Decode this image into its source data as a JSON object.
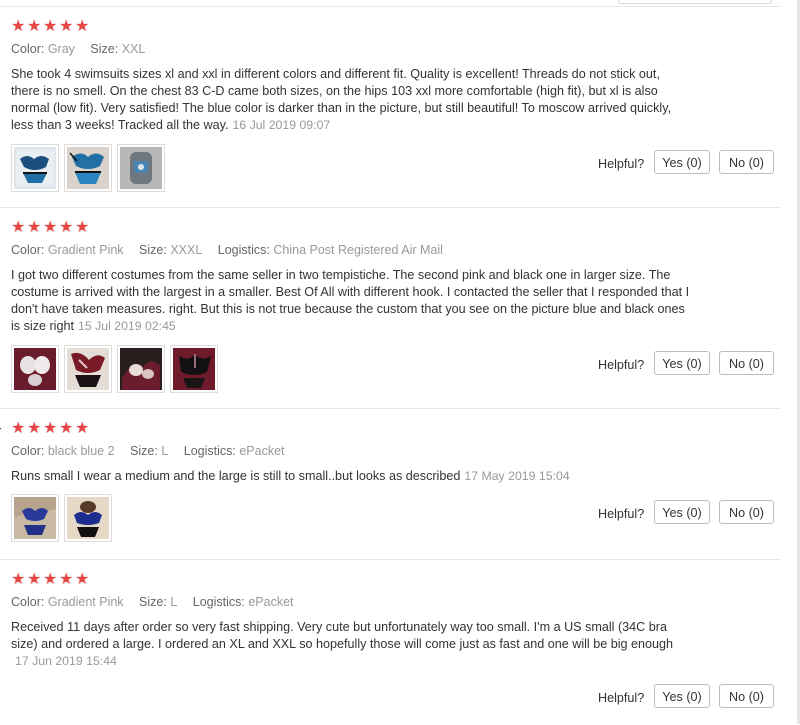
{
  "labels": {
    "color": "Color:",
    "size": "Size:",
    "logistics": "Logistics:",
    "helpful": "Helpful?",
    "star_glyph": "★"
  },
  "icons": {
    "star": "star-icon"
  },
  "colors": {
    "star": "#e64545",
    "meta": "#999999",
    "text": "#333333",
    "border": "#bdbdbd"
  },
  "reviews": [
    {
      "rating": 5,
      "color": "Gray",
      "size": "XXL",
      "logistics": "",
      "text": "She took 4 swimsuits sizes xl and xxl in different colors and different fit. Quality is excellent! Threads do not stick out, there is no smell. On the chest 83 C-D came both sizes, on the hips 103 xxl more comfortable (high fit), but xl is also normal (low fit). Very satisfied! The blue color is darker than in the picture, but still beautiful! To moscow arrived quickly, less than 3 weeks! Tracked all the way.",
      "date": "16 Jul 2019 09:07",
      "photo_count": 3,
      "yes_label": "Yes (0)",
      "no_label": "No (0)"
    },
    {
      "rating": 5,
      "color": "Gradient Pink",
      "size": "XXXL",
      "logistics": "China Post Registered Air Mail",
      "text": "I got two different costumes from the same seller in two tempistiche. The second pink and black one in larger size. The costume is arrived with the largest in a smaller. Best Of All with different hook. I contacted the seller that I responded that I don't have taken measures. right. But this is not true because the custom that you see on the picture blue and black ones is size right",
      "date": "15 Jul 2019 02:45",
      "photo_count": 4,
      "yes_label": "Yes (0)",
      "no_label": "No (0)"
    },
    {
      "rating": 5,
      "color": "black blue 2",
      "size": "L",
      "logistics": "ePacket",
      "text": "Runs small I wear a medium and the large is still to small..but looks as described",
      "date": "17 May 2019 15:04",
      "photo_count": 2,
      "yes_label": "Yes (0)",
      "no_label": "No (0)"
    },
    {
      "rating": 5,
      "color": "Gradient Pink",
      "size": "L",
      "logistics": "ePacket",
      "text": "Received 11 days after order so very fast shipping. Very cute but unfortunately way too small. I'm a US small (34C bra size) and ordered a large. I ordered an XL and XXL so hopefully those will come just as fast and one will be big enough",
      "date": "17 Jun 2019 15:44",
      "photo_count": 0,
      "yes_label": "Yes (0)",
      "no_label": "No (0)"
    }
  ]
}
